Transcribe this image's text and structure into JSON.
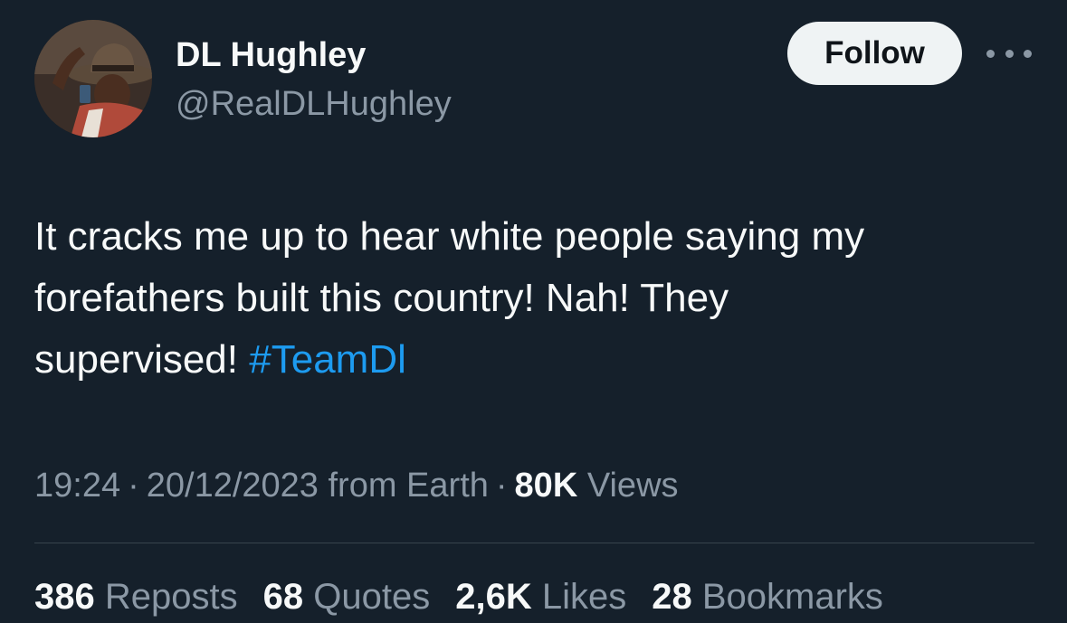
{
  "author": {
    "display_name": "DL Hughley",
    "handle": "@RealDLHughley",
    "follow_label": "Follow"
  },
  "tweet": {
    "lines": [
      "It cracks me up to hear white people saying my",
      "forefathers built this country! Nah! They",
      "supervised!"
    ],
    "hashtag": "#TeamDl"
  },
  "meta": {
    "time": "19:24",
    "separator": "·",
    "date": "20/12/2023",
    "source": "from Earth",
    "views_count": "80K",
    "views_label": "Views"
  },
  "stats": {
    "reposts": {
      "count": "386",
      "label": "Reposts"
    },
    "quotes": {
      "count": "68",
      "label": "Quotes"
    },
    "likes": {
      "count": "2,6K",
      "label": "Likes"
    },
    "bookmarks": {
      "count": "28",
      "label": "Bookmarks"
    }
  },
  "icons": {
    "more": "more-horizontal-icon"
  },
  "colors": {
    "background": "#15202b",
    "text_primary": "#f7f9f9",
    "text_secondary": "#8b98a5",
    "link": "#1d9bf0",
    "button_bg": "#eff3f4",
    "divider": "#38444d"
  }
}
